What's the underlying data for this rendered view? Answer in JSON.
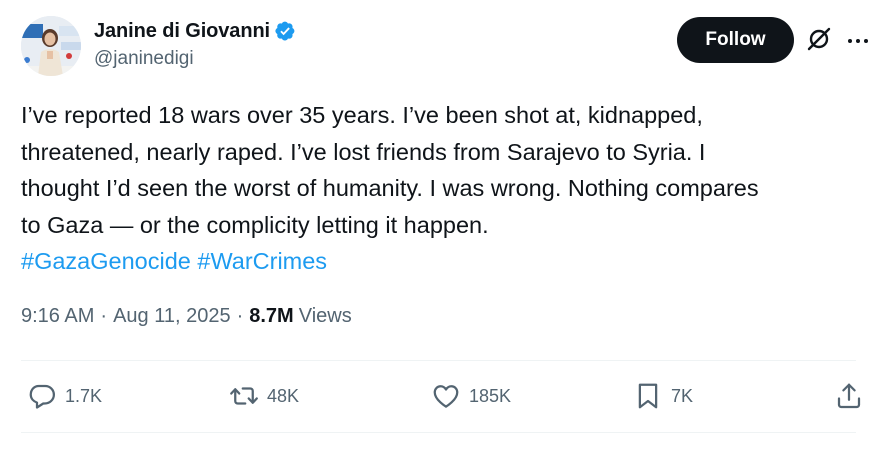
{
  "user": {
    "display_name": "Janine di Giovanni",
    "handle": "@janinedigi",
    "verified_icon": "verified-badge-icon",
    "avatar": "profile-photo"
  },
  "follow_label": "Follow",
  "tweet": {
    "lines": [
      "I’ve reported 18 wars over 35 years. I’ve been shot at, kidnapped,",
      "threatened, nearly raped. I’ve lost friends from Sarajevo to Syria. I",
      "thought I’d seen the worst of humanity. I was wrong. Nothing compares",
      "to Gaza — or the complicity letting it happen."
    ],
    "hashtags": [
      "#GazaGenocide",
      "#WarCrimes"
    ]
  },
  "meta": {
    "time": "9:16 AM",
    "separator": "·",
    "date": "Aug 11, 2025",
    "views_count": "8.7M",
    "views_label": "Views"
  },
  "actions": {
    "replies": "1.7K",
    "reposts": "48K",
    "likes": "185K",
    "bookmarks": "7K"
  },
  "colors": {
    "text": "#0f1419",
    "secondary": "#536471",
    "link": "#1d9bf0",
    "follow_bg": "#0f1419",
    "divider": "#eff3f4"
  }
}
